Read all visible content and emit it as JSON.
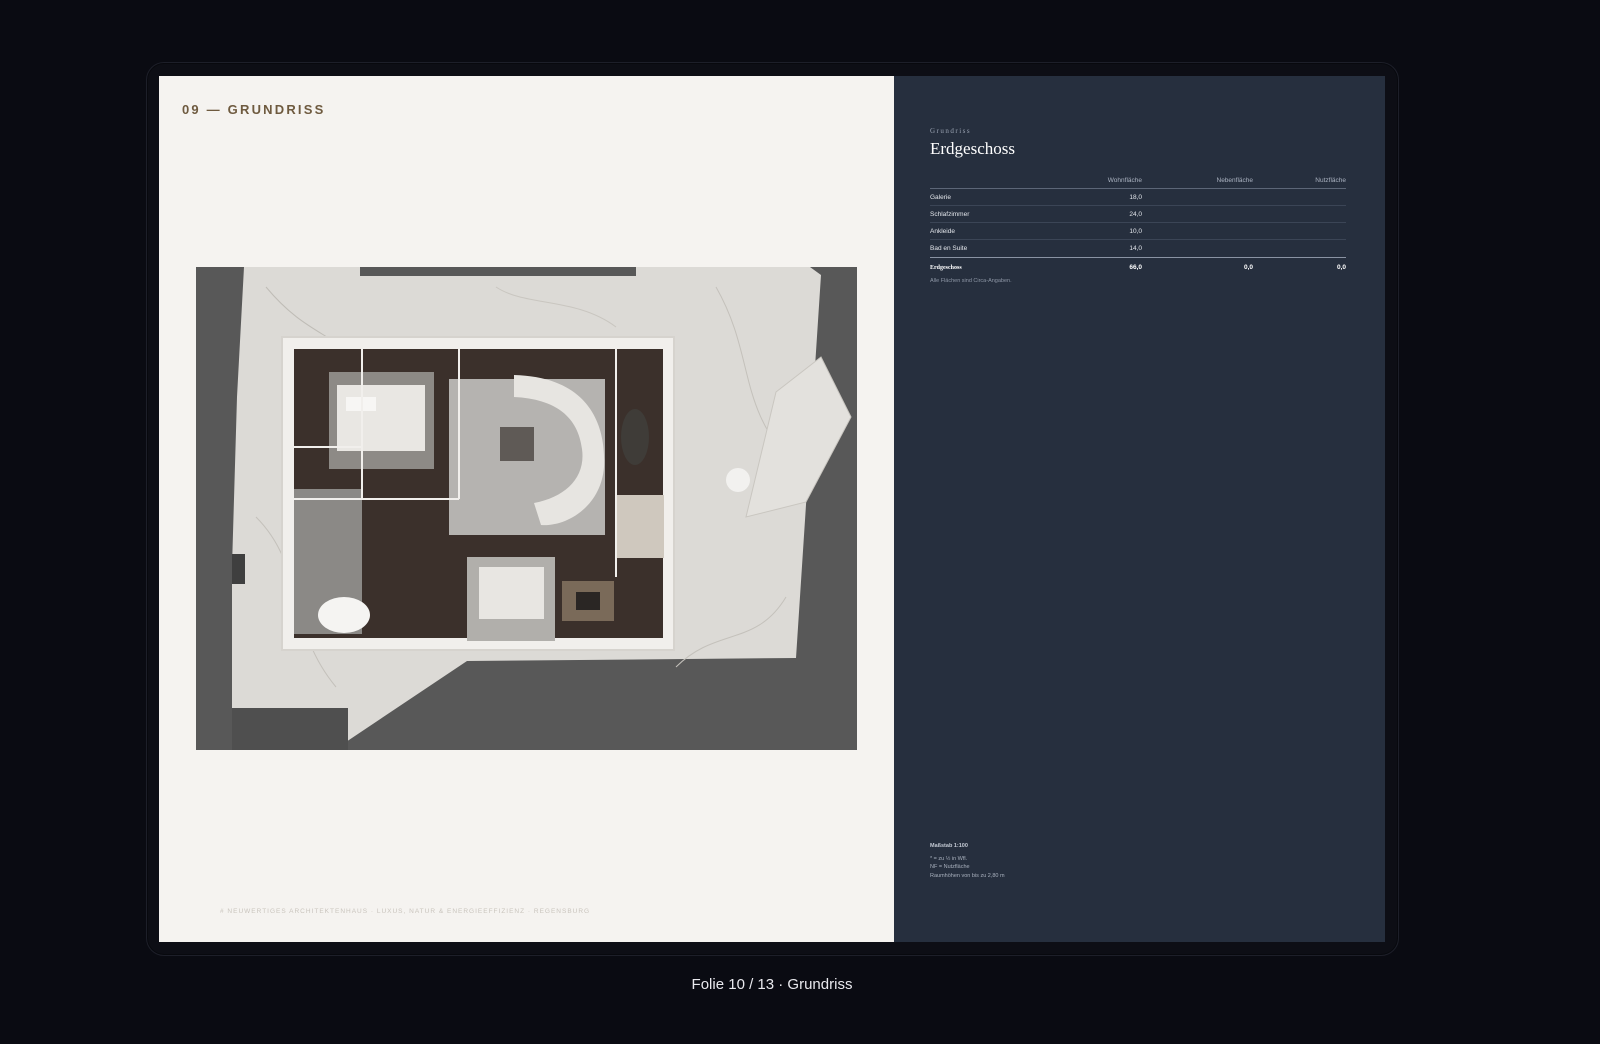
{
  "slide": {
    "section_label": "09 — GRUNDRISS",
    "footer_note": "# NEUWERTIGES ARCHITEKTENHAUS · LUXUS, NATUR & ENERGIEEFFIZIENZ · REGENSBURG"
  },
  "floorplan": {
    "image_alt_icon": "floorplan-render"
  },
  "panel": {
    "eyebrow": "Grundriss",
    "title": "Erdgeschoss",
    "columns": [
      "",
      "Wohnfläche",
      "Nebenfläche",
      "Nutzfläche"
    ],
    "rows": [
      {
        "room": "Galerie",
        "wohn": "18,0",
        "neben": "",
        "nutz": ""
      },
      {
        "room": "Schlafzimmer",
        "wohn": "24,0",
        "neben": "",
        "nutz": ""
      },
      {
        "room": "Ankleide",
        "wohn": "10,0",
        "neben": "",
        "nutz": ""
      },
      {
        "room": "Bad en Suite",
        "wohn": "14,0",
        "neben": "",
        "nutz": ""
      }
    ],
    "total": {
      "room": "Erdgeschoss",
      "wohn": "66,0",
      "neben": "0,0",
      "nutz": "0,0"
    },
    "note": "Alle Flächen sind Circa-Angaben.",
    "legend": {
      "scale": "Maßstab 1:100",
      "line1": "* = zu ½ in Wfl.",
      "line2": "NF = Nutzfläche",
      "line3": "Raumhöhen von bis zu 2,80 m"
    }
  },
  "caption": "Folie 10 / 13 · Grundriss",
  "colors": {
    "background": "#0a0b12",
    "slide_left": "#f5f3f0",
    "slide_right": "#262f3e",
    "accent_label": "#6e5a3f"
  }
}
